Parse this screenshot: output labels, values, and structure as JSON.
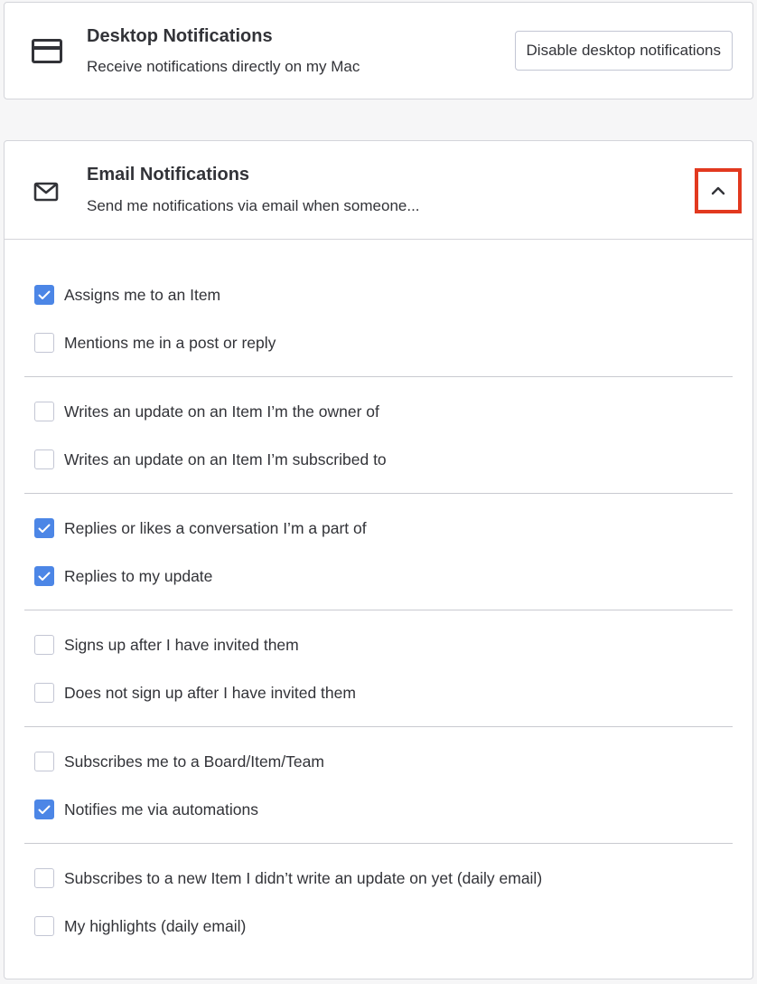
{
  "desktop": {
    "title": "Desktop Notifications",
    "subtitle": "Receive notifications directly on my Mac",
    "button_label": "Disable desktop notifications",
    "icon": "credit-card-like-desktop-icon"
  },
  "email": {
    "title": "Email Notifications",
    "subtitle": "Send me notifications via email when someone...",
    "icon": "envelope-icon",
    "collapse_icon": "chevron-up-icon",
    "highlight_color": "#e2391f",
    "checkbox_color": "#4c86e6",
    "options": [
      {
        "label": "Assigns me to an Item",
        "checked": true
      },
      {
        "label": "Mentions me in a post or reply",
        "checked": false
      },
      {
        "label": "Writes an update on an Item I’m the owner of",
        "checked": false
      },
      {
        "label": "Writes an update on an Item I’m subscribed to",
        "checked": false
      },
      {
        "label": "Replies or likes a conversation I’m a part of",
        "checked": true
      },
      {
        "label": "Replies to my update",
        "checked": true
      },
      {
        "label": "Signs up after I have invited them",
        "checked": false
      },
      {
        "label": "Does not sign up after I have invited them",
        "checked": false
      },
      {
        "label": "Subscribes me to a Board/Item/Team",
        "checked": false
      },
      {
        "label": "Notifies me via automations",
        "checked": true
      },
      {
        "label": "Subscribes to a new Item I didn’t write an update on yet (daily email)",
        "checked": false
      },
      {
        "label": "My highlights (daily email)",
        "checked": false
      }
    ]
  }
}
